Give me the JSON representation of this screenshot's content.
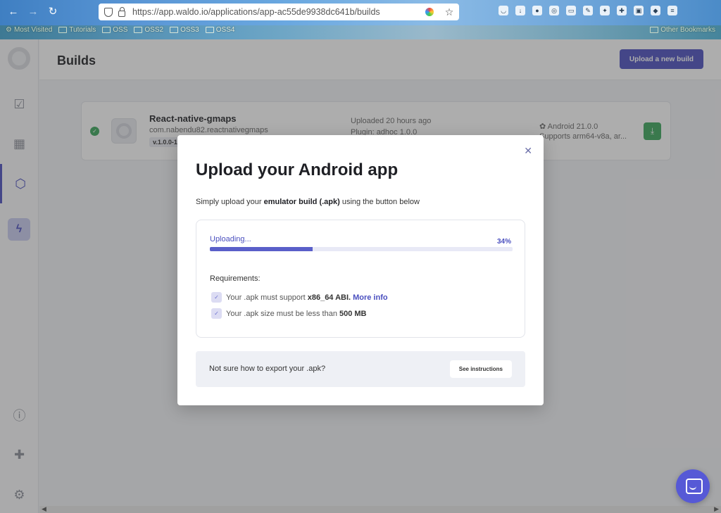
{
  "browser": {
    "url": "https://app.waldo.io/applications/app-ac55de9938dc641b/builds",
    "bookmarks": [
      "Most Visited",
      "Tutorials",
      "OSS",
      "OSS2",
      "OSS3",
      "OSS4"
    ],
    "other_bookmarks": "Other Bookmarks",
    "toolbar_icons": [
      "pocket-icon",
      "download-icon",
      "ext-twd-icon",
      "ext-globe-icon",
      "ext-slides-icon",
      "ext-note-icon",
      "ext-bird-icon",
      "ext-puzzle-icon",
      "ext-iq-icon",
      "ext-color-icon",
      "menu-icon"
    ]
  },
  "sidebar": {
    "items": [
      "checklist-icon",
      "chip-icon",
      "cube-icon",
      "bolt-icon",
      "help-icon",
      "puzzle-icon",
      "gear-icon"
    ]
  },
  "header": {
    "title": "Builds",
    "upload_label": "Upload a new build"
  },
  "build": {
    "name": "React-native-gmaps",
    "package": "com.nabendu82.reactnativegmaps",
    "version": "v.1.0.0-1",
    "uploaded": "Uploaded 20 hours ago",
    "plugin": "Plugin: adhoc 1.0.0",
    "android": "Android 21.0.0",
    "supports": "Supports arm64-v8a, ar..."
  },
  "modal": {
    "title": "Upload your Android app",
    "subtitle_pre": "Simply upload your",
    "subtitle_bold": "emulator build (.apk)",
    "subtitle_post": "using the button below",
    "status": "Uploading...",
    "progress": 34,
    "progress_label": "34%",
    "requirements_title": "Requirements:",
    "req1_pre": "Your .apk must support",
    "req1_bold": "x86_64 ABI.",
    "req1_link": "More info",
    "req2_pre": "Your .apk size must be less than",
    "req2_bold": "500 MB",
    "help_text": "Not sure how to export your .apk?",
    "help_button": "See instructions"
  },
  "colors": {
    "accent": "#4a4fbf",
    "success": "#3aa55a"
  }
}
